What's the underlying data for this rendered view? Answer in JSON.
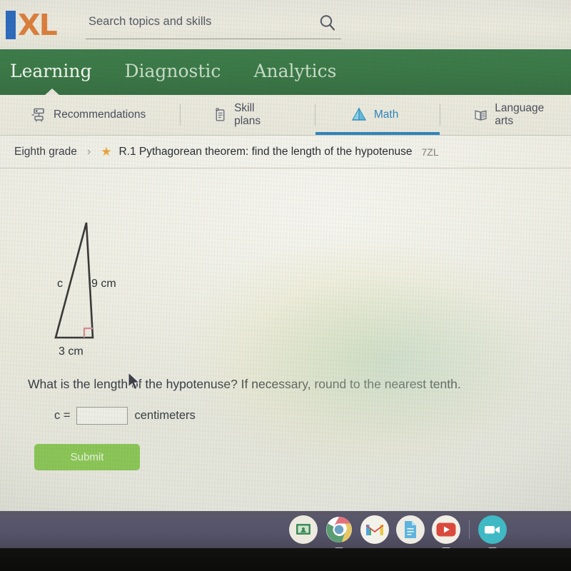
{
  "app": {
    "brand": "IXL",
    "brand_letter_i": "I",
    "brand_letters_xl": "XL"
  },
  "search": {
    "placeholder": "Search topics and skills",
    "value": "",
    "icon": "search-icon"
  },
  "green_nav": {
    "items": [
      {
        "label": "Learning",
        "active": true
      },
      {
        "label": "Diagnostic",
        "active": false
      },
      {
        "label": "Analytics",
        "active": false
      }
    ]
  },
  "tabs": [
    {
      "label": "Recommendations",
      "icon": "recommendations-icon",
      "active": false
    },
    {
      "label": "Skill plans",
      "icon": "skill-plans-icon",
      "active": false
    },
    {
      "label": "Math",
      "icon": "math-pyramid-icon",
      "active": true
    },
    {
      "label": "Language arts",
      "icon": "open-book-icon",
      "active": false
    }
  ],
  "breadcrumb": {
    "grade": "Eighth grade",
    "separator": "›",
    "star": "★",
    "skill_title": "R.1 Pythagorean theorem: find the length of the hypotenuse",
    "skill_code": "7ZL"
  },
  "problem": {
    "question": "What is the length of the hypotenuse? If necessary, round to the nearest tenth.",
    "variable_label": "c =",
    "answer_value": "",
    "units": "centimeters",
    "submit_label": "Submit"
  },
  "figure": {
    "type": "right-triangle",
    "hypotenuse_label": "c",
    "vertical_side_label": "9 cm",
    "base_label": "3 cm",
    "right_angle_marker": true,
    "stroke_color": "#3a3a38",
    "right_angle_color": "#d98a96"
  },
  "colors": {
    "nav_green": "#3c7a48",
    "tab_active_blue": "#2f86bf",
    "submit_green": "#8cc658",
    "star_orange": "#eba43c",
    "logo_blue": "#2f6bbf",
    "logo_orange": "#dd7f3e"
  },
  "dock": {
    "items": [
      {
        "name": "google-classroom-icon",
        "label": "Google Classroom"
      },
      {
        "name": "chrome-icon",
        "label": "Chrome"
      },
      {
        "name": "gmail-icon",
        "label": "Gmail"
      },
      {
        "name": "google-docs-icon",
        "label": "Docs"
      },
      {
        "name": "youtube-icon",
        "label": "YouTube"
      },
      {
        "name": "video-camera-icon",
        "label": "Video call"
      }
    ]
  }
}
